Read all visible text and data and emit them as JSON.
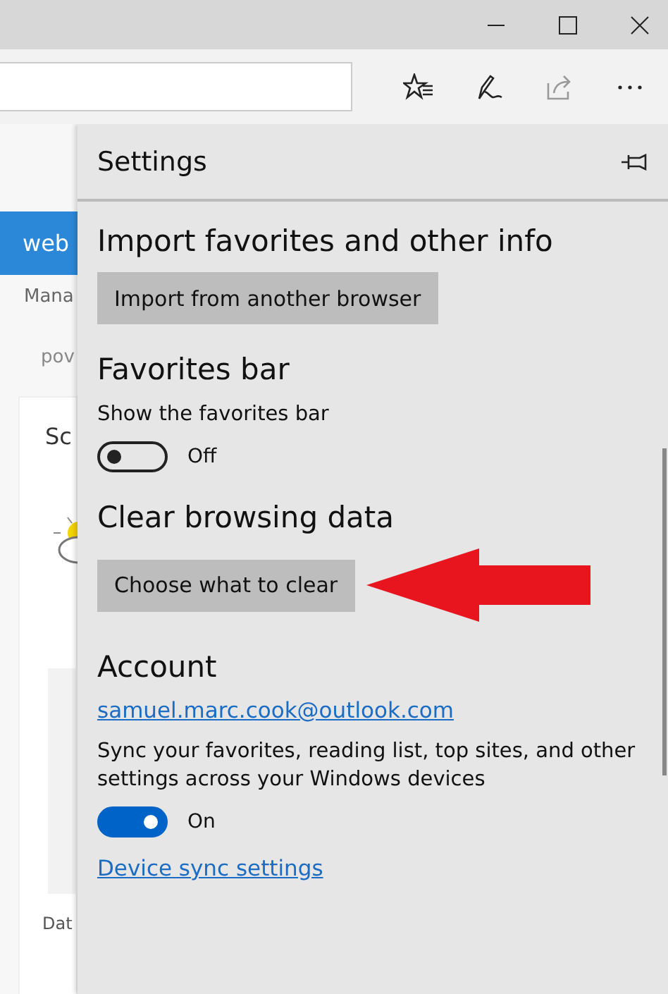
{
  "background_page": {
    "banner_text": "web",
    "texts": [
      "Mana",
      "pov"
    ],
    "card_title": "Sc",
    "footer_text": "Dat"
  },
  "settings": {
    "title": "Settings",
    "sections": [
      {
        "kind": "button",
        "heading": "Import favorites and other info",
        "button": "Import from another browser",
        "annotated": false
      },
      {
        "kind": "toggle",
        "heading": "Favorites bar",
        "label": "Show the favorites bar",
        "on": false,
        "state_text": "Off"
      },
      {
        "kind": "button",
        "heading": "Clear browsing data",
        "button": "Choose what to clear",
        "annotated": true
      },
      {
        "kind": "account",
        "heading": "Account",
        "email": "samuel.marc.cook@outlook.com",
        "description": "Sync your favorites, reading list, top sites, and other settings across your Windows devices",
        "on": true,
        "state_text": "On",
        "link": "Device sync settings"
      }
    ]
  }
}
